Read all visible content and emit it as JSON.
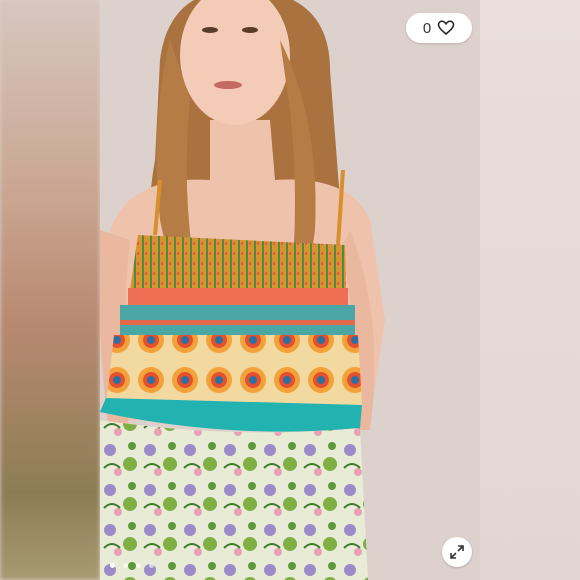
{
  "like": {
    "count": "0",
    "icon": "heart-outline-icon"
  },
  "gallery": {
    "image": "product-photo",
    "dots": [
      true,
      false,
      false,
      false
    ],
    "expand_icon": "expand-arrows-icon"
  },
  "colors": {
    "background": "#dcd0cb",
    "pill": "#ffffff",
    "top_orange": "#d98a2b",
    "top_coral": "#ef6f55",
    "top_teal": "#2ab5b0",
    "skirt_green": "#8aa844"
  }
}
